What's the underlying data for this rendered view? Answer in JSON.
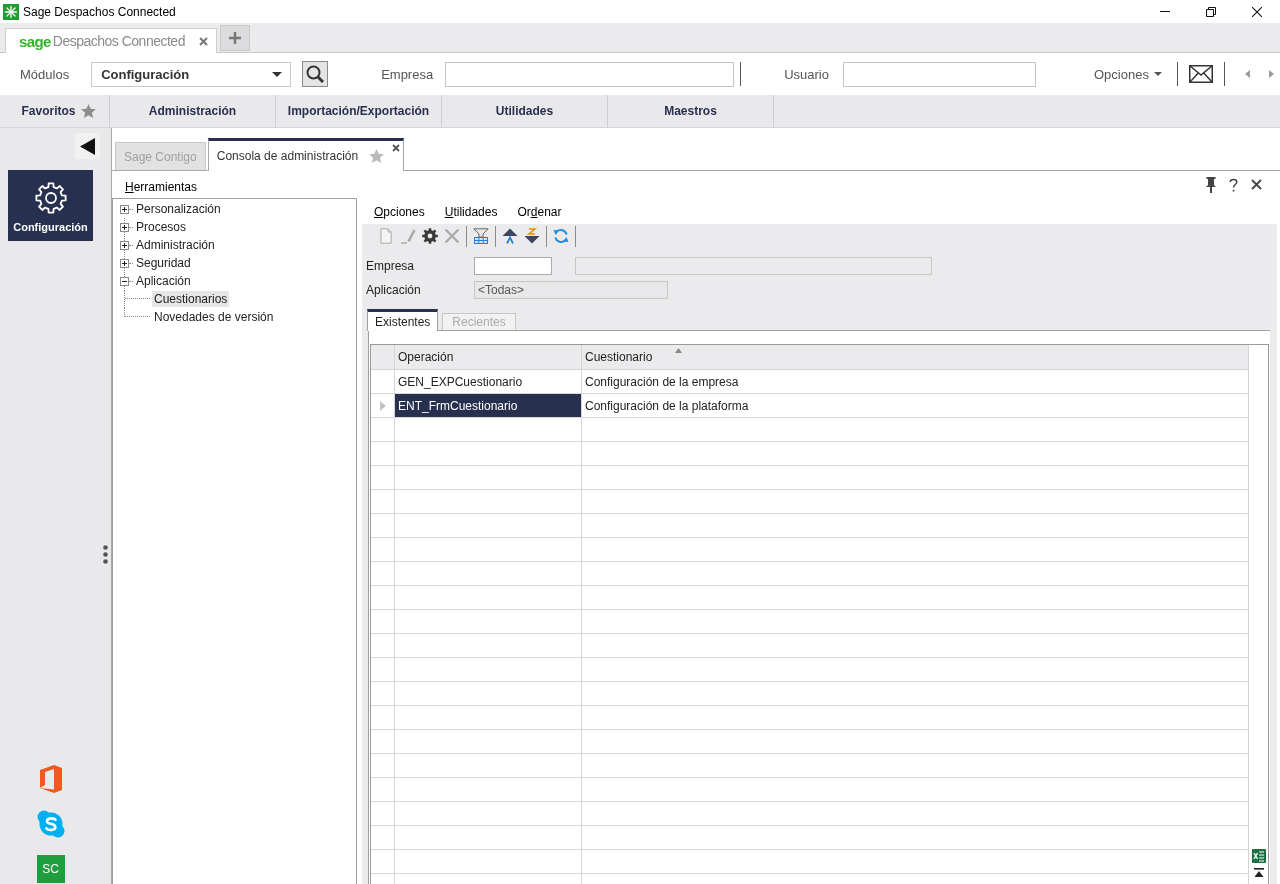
{
  "window": {
    "title": "Sage Despachos Connected"
  },
  "app_tabs": [
    {
      "brand": "sage",
      "label": "Despachos Connected",
      "selected": true
    }
  ],
  "toolbar": {
    "module_label": "Módulos",
    "module_value": "Configuración",
    "company_label": "Empresa",
    "user_label": "Usuario",
    "options_label": "Opciones"
  },
  "main_menu": [
    {
      "label": "Favoritos",
      "kind": "favorites"
    },
    {
      "label": "Administración",
      "kind": "section"
    },
    {
      "label": "Importación/Exportación",
      "kind": "section"
    },
    {
      "label": "Utilidades",
      "kind": "section"
    },
    {
      "label": "Maestros",
      "kind": "section"
    }
  ],
  "sidebar": {
    "modules": [
      {
        "label": "Configuración",
        "selected": true
      }
    ],
    "apps": [
      {
        "kind": "office"
      },
      {
        "kind": "skype"
      },
      {
        "kind": "tile",
        "label": "SC"
      }
    ]
  },
  "document_tabs": [
    {
      "label": "Sage Contigo",
      "kind": "fixed",
      "selected": false
    },
    {
      "label": "Consola de administración",
      "kind": "document",
      "selected": true
    }
  ],
  "tools_menu": {
    "label_parts": [
      {
        "text": "H",
        "underlined": true
      },
      {
        "text": "erramientas",
        "underlined": false
      }
    ]
  },
  "tree": [
    {
      "label": "Personalización",
      "expanded": false,
      "selected": false
    },
    {
      "label": "Procesos",
      "expanded": false,
      "selected": false
    },
    {
      "label": "Administración",
      "expanded": false,
      "selected": false
    },
    {
      "label": "Seguridad",
      "expanded": false,
      "selected": false
    },
    {
      "label": "Aplicación",
      "expanded": true,
      "selected": false,
      "children": [
        {
          "label": "Cuestionarios",
          "selected": true
        },
        {
          "label": "Novedades de versión",
          "selected": false
        }
      ]
    }
  ],
  "panel_menu": [
    {
      "label_parts": [
        {
          "text": "O",
          "underlined": true
        },
        {
          "text": "pciones",
          "underlined": false
        }
      ]
    },
    {
      "label_parts": [
        {
          "text": "U",
          "underlined": true
        },
        {
          "text": "tilidades",
          "underlined": false
        }
      ]
    },
    {
      "label_parts": [
        {
          "text": "Or",
          "underlined": false
        },
        {
          "text": "d",
          "underlined": true
        },
        {
          "text": "enar",
          "underlined": false
        }
      ]
    }
  ],
  "panel_toolbar": [
    {
      "buttons": [
        {
          "kind": "new",
          "disabled": true
        },
        {
          "kind": "edit",
          "disabled": true
        },
        {
          "kind": "settings",
          "disabled": false
        },
        {
          "kind": "delete",
          "disabled": true
        }
      ]
    },
    {
      "buttons": [
        {
          "kind": "filter",
          "disabled": false
        }
      ]
    },
    {
      "buttons": [
        {
          "kind": "sort_ascending",
          "disabled": false
        },
        {
          "kind": "sort_descending",
          "disabled": false
        }
      ]
    },
    {
      "buttons": [
        {
          "kind": "refresh",
          "disabled": false
        }
      ]
    }
  ],
  "filters": [
    {
      "label": "Empresa",
      "kind": "lookup"
    },
    {
      "label": "Aplicación",
      "kind": "select",
      "value": "<Todas>"
    }
  ],
  "result_tabs": [
    {
      "label": "Existentes",
      "selected": true
    },
    {
      "label": "Recientes",
      "selected": false
    }
  ],
  "grid": {
    "columns": [
      {
        "label": "Operación",
        "sorted": false
      },
      {
        "label": "Cuestionario",
        "sorted": true
      }
    ],
    "rows": [
      {
        "cells": [
          "GEN_EXPCuestionario",
          "Configuración de la empresa"
        ],
        "selected": false
      },
      {
        "cells": [
          "ENT_FrmCuestionario",
          "Configuración de la plataforma"
        ],
        "selected": true
      }
    ]
  }
}
